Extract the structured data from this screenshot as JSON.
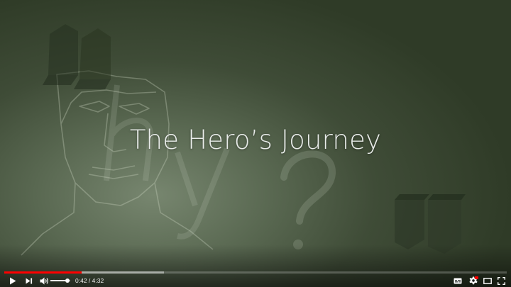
{
  "video": {
    "title_overlay": "The Hero’s Journey"
  },
  "player": {
    "current_time": "0:42",
    "time_separator": " / ",
    "duration": "4:32",
    "played_fraction": 0.154,
    "buffered_fraction": 0.318,
    "volume_fraction": 0.85
  },
  "colors": {
    "progress_played": "#ff0000",
    "background": "#33402b"
  },
  "icons": {
    "play": "play-icon",
    "next": "next-icon",
    "volume": "volume-icon",
    "subtitles": "subtitles-icon",
    "settings": "settings-icon",
    "theater": "theater-mode-icon",
    "fullscreen": "fullscreen-icon"
  }
}
